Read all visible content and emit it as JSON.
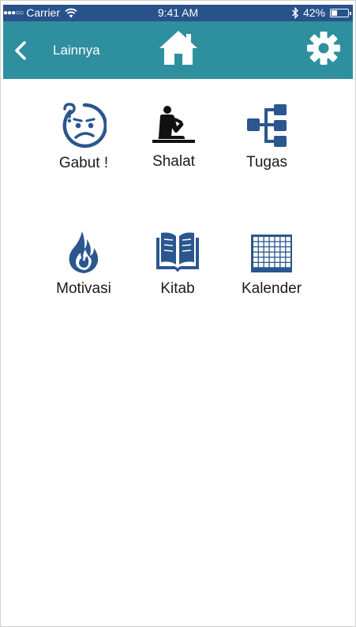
{
  "status_bar": {
    "signal": "●●●○○",
    "carrier": "Carrier",
    "time": "9:41 AM",
    "battery_percent": "42%",
    "battery_level": 0.42
  },
  "nav": {
    "title": "Lainnya",
    "back_icon": "chevron-left-icon",
    "home_icon": "home-icon",
    "settings_icon": "gear-icon"
  },
  "colors": {
    "status_bar": "#27528a",
    "nav_bar": "#2e8f9e",
    "icon_blue": "#2b568e",
    "icon_black": "#111111"
  },
  "menu": {
    "items": [
      {
        "label": "Gabut !",
        "icon": "confused-face-icon"
      },
      {
        "label": "Shalat",
        "icon": "prayer-icon"
      },
      {
        "label": "Tugas",
        "icon": "sitemap-icon"
      },
      {
        "label": "Motivasi",
        "icon": "flame-icon"
      },
      {
        "label": "Kitab",
        "icon": "book-icon"
      },
      {
        "label": "Kalender",
        "icon": "calendar-grid-icon"
      }
    ]
  }
}
